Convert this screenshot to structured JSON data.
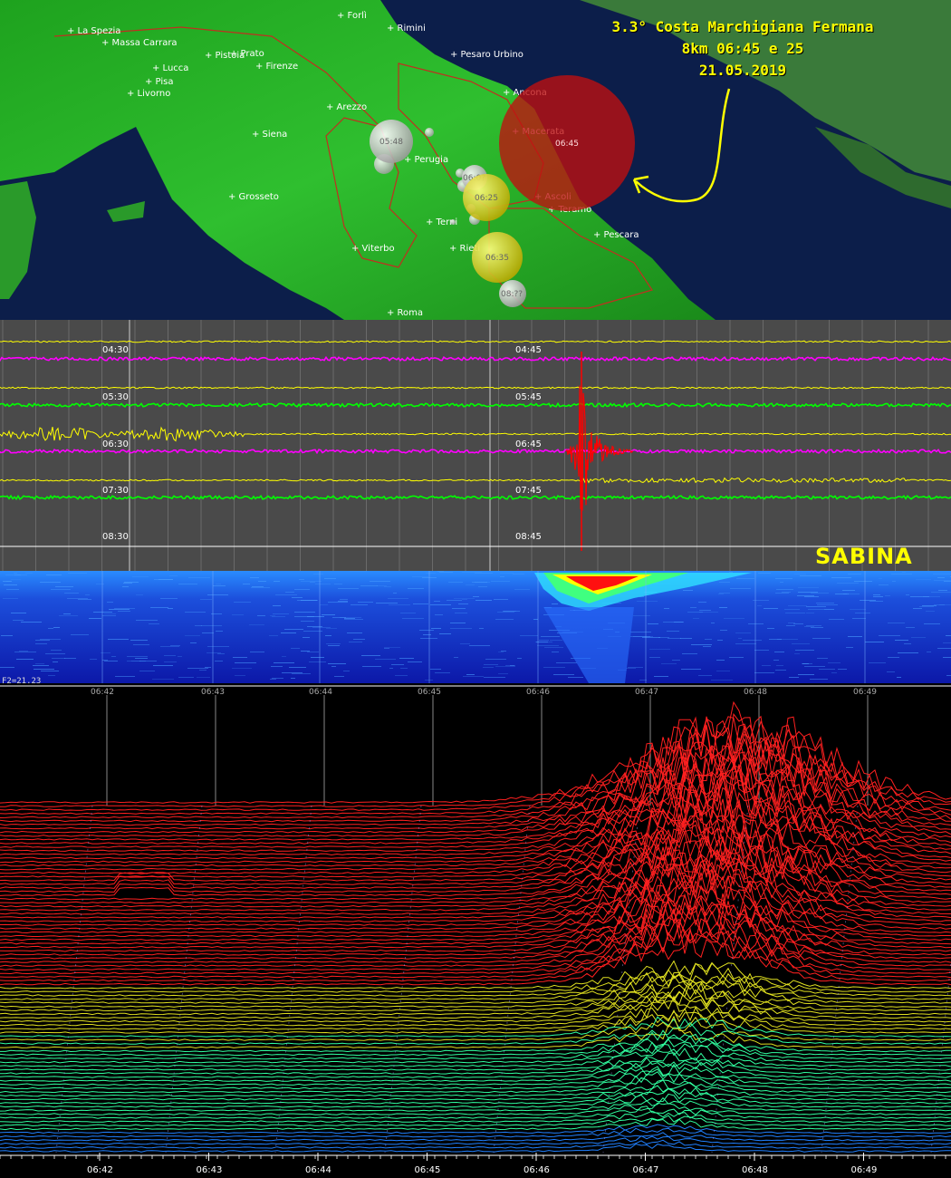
{
  "map": {
    "caption": [
      "3.3° Costa Marchigiana Fermana",
      "8km 06:45 e 25",
      "21.05.2019"
    ],
    "cities": [
      "Forlì",
      "Rimini",
      "La Spezia",
      "Massa Carrara",
      "Pistoia",
      "Prato",
      "Firenze",
      "Lucca",
      "Pisa",
      "Livorno",
      "Pesaro Urbino",
      "Ancona",
      "Arezzo",
      "Siena",
      "Macerata",
      "Perugia",
      "Grosseto",
      "Ascoli",
      "Teramo",
      "Terni",
      "Pescara",
      "Viterbo",
      "Rieti",
      "Roma"
    ],
    "events": [
      {
        "time": "06:45",
        "color": "#c01010",
        "highlight": true
      },
      {
        "time": "05:48",
        "color": "#d8d8d8"
      },
      {
        "time": "06:0?",
        "color": "#d0d0d0"
      },
      {
        "time": "06:25",
        "color": "#e0d000"
      },
      {
        "time": "06:35",
        "color": "#e8e000"
      },
      {
        "time": "08:??",
        "color": "#d0d0d0"
      }
    ]
  },
  "seismogram": {
    "station": "SABINA",
    "row_labels_left": [
      "04:30",
      "05:30",
      "06:30",
      "07:30",
      "08:30"
    ],
    "row_labels_right": [
      "04:45",
      "05:45",
      "06:45",
      "07:45",
      "08:45"
    ],
    "trace_colors": [
      "#ffff00",
      "#ff00ff",
      "#ffff00",
      "#00ff00",
      "#ffff00",
      "#ff00ff",
      "#ffff00",
      "#00ff00"
    ]
  },
  "spectrogram": {
    "scale_label": "F2=21.23",
    "time_labels": [
      "06:42",
      "06:43",
      "06:44",
      "06:45",
      "06:46",
      "06:47",
      "06:48",
      "06:49"
    ]
  },
  "chart_data": {
    "type": "waterfall",
    "title": "",
    "x_ticks": [
      "06:42",
      "06:43",
      "06:44",
      "06:45",
      "06:46",
      "06:47",
      "06:48",
      "06:49"
    ],
    "event_time": "06:47",
    "peak_time": "06:47:20",
    "colors": {
      "low": "#1040ff",
      "mid": "#30ff80",
      "high": "#ff2020",
      "background": "#000000"
    }
  }
}
